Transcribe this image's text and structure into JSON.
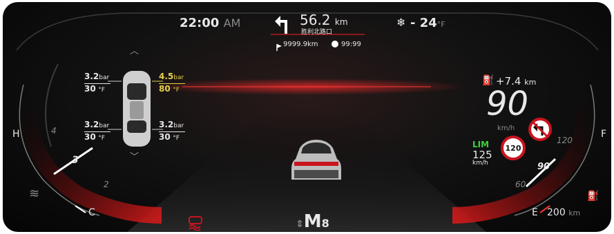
{
  "header": {
    "time": "22:00",
    "ampm": "AM",
    "nav_distance": "56.2",
    "nav_distance_unit": "km",
    "nav_street": "胜利北路口",
    "remaining_distance": "9999.9km",
    "remaining_time": "99:99",
    "temperature": "- 24",
    "temperature_unit": "°F"
  },
  "tires": {
    "front_left": {
      "pressure": "3.2",
      "pressure_unit": "bar",
      "temp": "30",
      "temp_unit": "°F"
    },
    "front_right": {
      "pressure": "4.5",
      "pressure_unit": "bar",
      "temp": "80",
      "temp_unit": "°F",
      "warning": true
    },
    "rear_left": {
      "pressure": "3.2",
      "pressure_unit": "bar",
      "temp": "30",
      "temp_unit": "°F"
    },
    "rear_right": {
      "pressure": "3.2",
      "pressure_unit": "bar",
      "temp": "30",
      "temp_unit": "°F"
    }
  },
  "left_gauge": {
    "hot_label": "H",
    "cold_label": "C",
    "ticks": [
      "4",
      "3",
      "2"
    ]
  },
  "right_gauge": {
    "full_label": "F",
    "empty_label": "E",
    "range": "200",
    "range_unit": "km",
    "ticks": [
      "120",
      "90",
      "60"
    ]
  },
  "speed": {
    "value": "90",
    "unit": "km/h",
    "fuel_gain": "+7.4",
    "fuel_gain_unit": "km"
  },
  "speed_limit": {
    "label": "LIM",
    "set_speed": "125",
    "set_unit": "km/h",
    "sign_value": "120"
  },
  "gear": {
    "mode": "M",
    "gear": "8"
  },
  "colors": {
    "accent_red": "#c8141e",
    "warning_yellow": "#e6d24a",
    "lim_green": "#3ed13e"
  },
  "icons": [
    "turn-left-arrow-icon",
    "flag-icon",
    "clock-icon",
    "snowflake-icon",
    "fuel-pump-icon",
    "coolant-temp-icon",
    "no-left-turn-sign-icon",
    "traction-control-icon",
    "chevron-up-icon",
    "chevron-down-icon"
  ]
}
